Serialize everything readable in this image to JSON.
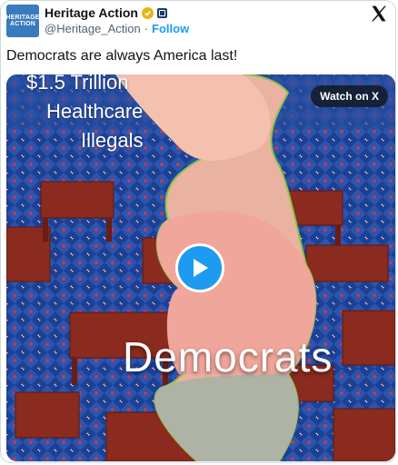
{
  "account": {
    "avatar_line1": "HERITAGE",
    "avatar_line2": "ACTION",
    "name": "Heritage Action",
    "handle": "@Heritage_Action",
    "separator": "·",
    "follow_label": "Follow"
  },
  "tweet": {
    "text": "Democrats are always America last!"
  },
  "media": {
    "watch_label": "Watch on X",
    "overlay_lines": [
      "$1.5 Trillion",
      "Healthcare",
      "Illegals"
    ],
    "caption": "Democrats"
  },
  "colors": {
    "brand_blue": "#1d9bf0",
    "avatar_blue": "#3a7abf",
    "verified_gold": "#e2b719"
  },
  "icons": {
    "verified": "gold-check-badge",
    "org": "affiliate-badge",
    "x_logo": "x-logo",
    "play": "play-icon"
  }
}
